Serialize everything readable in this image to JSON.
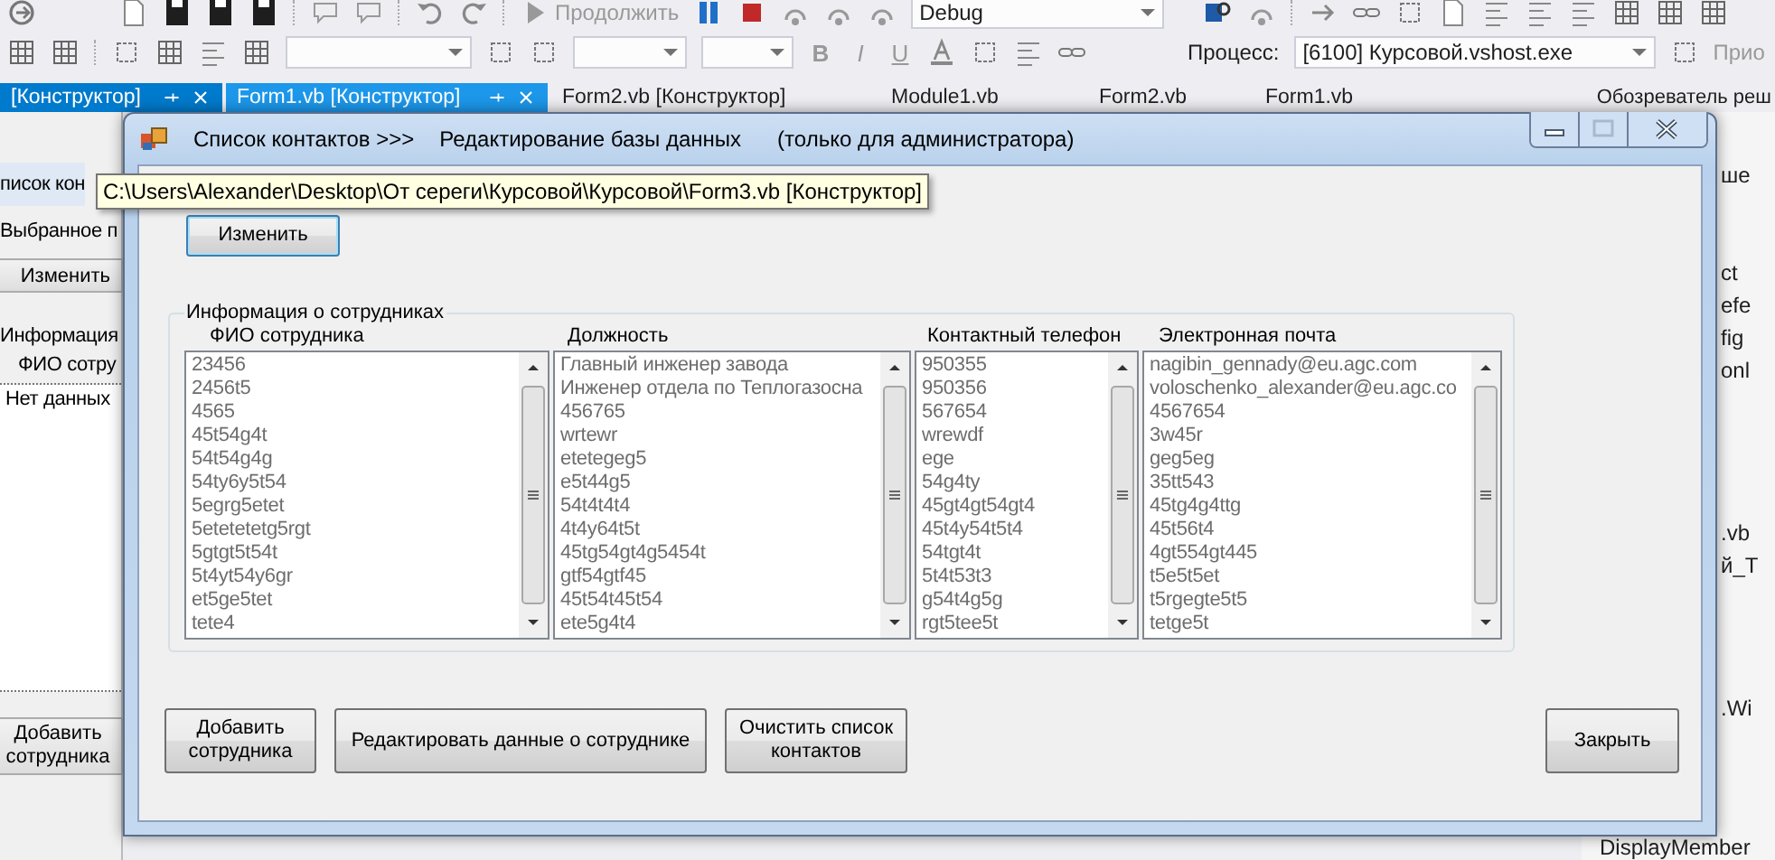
{
  "ide": {
    "toolbar": {
      "continue_button": "Продолжить",
      "configuration": "Debug",
      "format_buttons": [
        "B",
        "I",
        "U"
      ],
      "process_label": "Процесс:",
      "process": "[6100] Курсовой.vshost.exe",
      "cut_button": "Прио"
    },
    "tabs": [
      {
        "label": "[Конструктор]",
        "selected": true,
        "highlighted": false
      },
      {
        "label": "Form1.vb [Конструктор]",
        "selected": false,
        "highlighted": true
      },
      {
        "label": "Form2.vb [Конструктор]",
        "selected": false,
        "highlighted": false
      },
      {
        "label": "Module1.vb",
        "selected": false,
        "highlighted": false
      },
      {
        "label": "Form2.vb",
        "selected": false,
        "highlighted": false
      },
      {
        "label": "Form1.vb",
        "selected": false,
        "highlighted": false
      }
    ],
    "panel_title": "Обозреватель реш",
    "left_designer": {
      "form_title": "писок кон",
      "selected_label": "Выбранное п",
      "edit_button": "Изменить",
      "group_label": "Информация",
      "column_header": "ФИО сотру",
      "empty_text": "Нет данных",
      "add_button": "Добавить сотрудника"
    },
    "right_panel": {
      "items": [
        "ше",
        "ct",
        "efe",
        "fig",
        "onl",
        ".vb",
        "й_T",
        ".Wi"
      ],
      "property": "DisplayMember"
    }
  },
  "dialog": {
    "title_parts": [
      "Список контактов >>>",
      "Редактирование базы данных",
      "(только для администратора)"
    ],
    "tooltip": "C:\\Users\\Alexander\\Desktop\\От сереги\\Курсовой\\Курсовой\\Form3.vb [Конструктор]",
    "edit_button": "Изменить",
    "group": {
      "title": "Информация о сотрудниках",
      "lists": [
        {
          "header": "ФИО сотрудника",
          "items": [
            "23456",
            "2456t5",
            "4565",
            "45t54g4t",
            "54t54g4g",
            "54ty6y5t54",
            "5egrg5etet",
            "5etetetetg5rgt",
            "5gtgt5t54t",
            "5t4yt54y6gr",
            "et5ge5tet",
            "tete4"
          ]
        },
        {
          "header": "Должность",
          "items": [
            "Главный инженер завода",
            "Инженер отдела по Теплогазосна",
            "456765",
            "wrtewr",
            "etetegeg5",
            "e5t44g5",
            "54t4t4t4",
            "4t4y64t5t",
            "45tg54gt4g5454t",
            "gtf54gtf45",
            "45t54t45t54",
            "ete5g4t4"
          ]
        },
        {
          "header": "Контактный телефон",
          "items": [
            "950355",
            "950356",
            "567654",
            "wrewdf",
            "ege",
            "54g4ty",
            "45gt4gt54gt4",
            "45t4y54t5t4",
            "54tgt4t",
            "5t4t53t3",
            "g54t4g5g",
            "rgt5tee5t"
          ]
        },
        {
          "header": "Электронная почта",
          "items": [
            "nagibin_gennady@eu.agc.com",
            "voloschenko_alexander@eu.agc.co",
            "4567654",
            "3w45r",
            "geg5eg",
            "35tt543",
            "45tg4g4ttg",
            "45t56t4",
            "4gt554gt445",
            "t5e5t5et",
            "t5rgegte5t5",
            "tetge5t"
          ]
        }
      ]
    },
    "buttons": [
      {
        "label": "Добавить сотрудника"
      },
      {
        "label": "Редактировать данные о сотруднике"
      },
      {
        "label": "Очистить список контактов"
      },
      {
        "label": "Закрыть"
      }
    ]
  }
}
